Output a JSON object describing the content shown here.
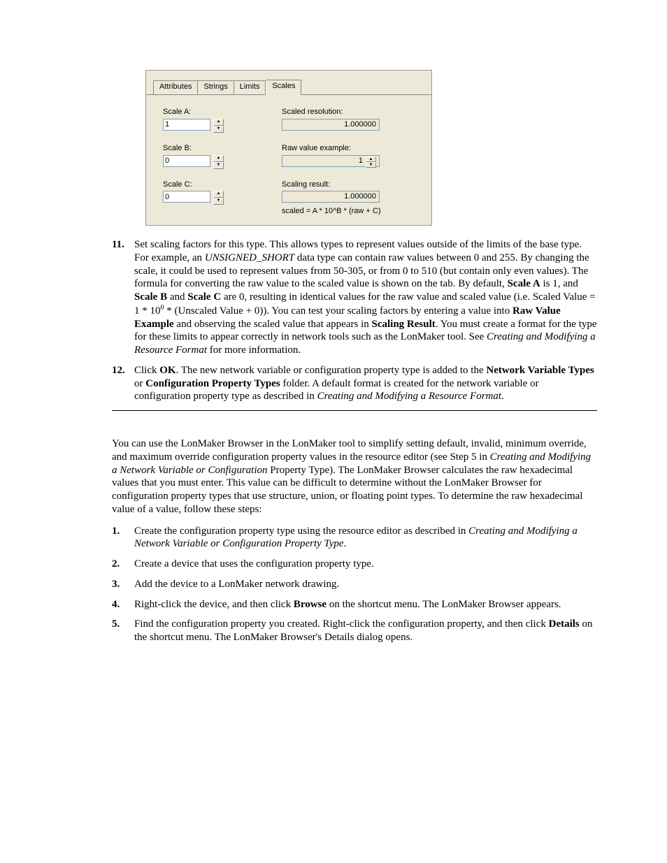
{
  "dialog": {
    "tabs": [
      "Attributes",
      "Strings",
      "Limits",
      "Scales"
    ],
    "active_tab": "Scales",
    "scale_a_label": "Scale A:",
    "scale_a_value": "1",
    "scale_b_label": "Scale B:",
    "scale_b_value": "0",
    "scale_c_label": "Scale C:",
    "scale_c_value": "0",
    "scaled_res_label": "Scaled resolution:",
    "scaled_res_value": "1.000000",
    "raw_label": "Raw value example:",
    "raw_value": "1",
    "result_label": "Scaling result:",
    "result_value": "1.000000",
    "formula": "scaled = A * 10^B * (raw + C)"
  },
  "step11": {
    "num": "11.",
    "p1a": "Set scaling factors for this type.  This allows types to represent values outside of the limits of the base type.  For example, an ",
    "p1b": "UNSIGNED_SHORT",
    "p1c": " data type can contain raw values between 0 and 255.  By changing the scale, it could be used to represent values from 50-305, or from 0 to 510 (but contain only even values).  The formula for converting the raw value to the scaled value is shown on the tab.  By default, ",
    "p1d": "Scale A",
    "p1e": " is 1, and ",
    "p1f": "Scale B",
    "p1g": " and ",
    "p1h": "Scale C",
    "p1i": " are 0, resulting in identical values for the raw value and scaled value (i.e. Scaled Value = 1 * 10",
    "p1j": "0",
    "p1k": " * (Unscaled Value + 0)).  You can test your scaling factors by entering a value into ",
    "p1l": "Raw Value Example",
    "p1m": " and observing the scaled value that appears in ",
    "p1n": "Scaling Result",
    "p1o": ".  You must create a format for the type for these limits to appear correctly in network tools such as the LonMaker tool.  See ",
    "p1p": "Creating and Modifying a Resource Format",
    "p1q": " for more information."
  },
  "step12": {
    "num": "12.",
    "a": "Click ",
    "b": "OK",
    "c": ".  The new network variable or configuration property type is added to the ",
    "d": "Network Variable Types",
    "e": " or ",
    "f": "Configuration Property Types",
    "g": " folder.  A default format is created for the network variable or configuration property type as described in ",
    "h": "Creating and Modifying a Resource Format",
    "i": "."
  },
  "intro": {
    "a": "You can use the LonMaker Browser in the LonMaker tool to simplify setting default, invalid, minimum override, and maximum override configuration property values in the resource editor (see Step 5 in ",
    "b": "Creating and Modifying a Network Variable or Configuration",
    "c": " Property Type).  The LonMaker Browser calculates the raw hexadecimal values that you must enter.  This value can be difficult to determine without the LonMaker Browser for configuration property types that use structure, union, or floating point types.  To determine the raw hexadecimal value of a value, follow these steps:"
  },
  "steps": [
    {
      "num": "1.",
      "parts": [
        {
          "t": "Create the configuration property type using the resource editor as described in "
        },
        {
          "t": "Creating and Modifying a Network Variable or Configuration Property Type",
          "i": true
        },
        {
          "t": "."
        }
      ]
    },
    {
      "num": "2.",
      "parts": [
        {
          "t": "Create a device that uses the configuration property type."
        }
      ]
    },
    {
      "num": "3.",
      "parts": [
        {
          "t": "Add the device to a LonMaker network drawing."
        }
      ]
    },
    {
      "num": "4.",
      "parts": [
        {
          "t": "Right-click the device, and then click "
        },
        {
          "t": "Browse",
          "b": true
        },
        {
          "t": " on the shortcut menu.  The LonMaker Browser appears."
        }
      ]
    },
    {
      "num": "5.",
      "parts": [
        {
          "t": "Find the configuration property you created.  Right-click the configuration property, and then click "
        },
        {
          "t": "Details",
          "b": true
        },
        {
          "t": " on the shortcut menu.  The LonMaker Browser's Details dialog opens."
        }
      ]
    }
  ]
}
